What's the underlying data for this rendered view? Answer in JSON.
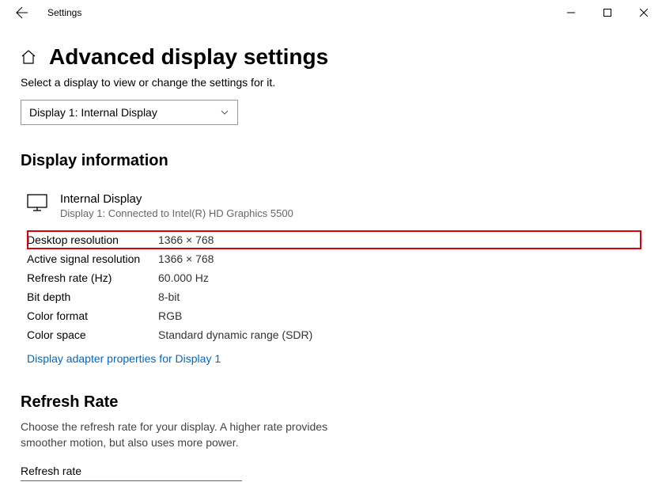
{
  "window": {
    "title": "Settings"
  },
  "page": {
    "heading": "Advanced display settings",
    "subtext": "Select a display to view or change the settings for it."
  },
  "dropdown": {
    "selected": "Display 1: Internal Display"
  },
  "section1": {
    "heading": "Display information",
    "display_name": "Internal Display",
    "display_sub": "Display 1: Connected to Intel(R) HD Graphics 5500"
  },
  "info": [
    {
      "label": "Desktop resolution",
      "value": "1366 × 768"
    },
    {
      "label": "Active signal resolution",
      "value": "1366 × 768"
    },
    {
      "label": "Refresh rate (Hz)",
      "value": "60.000 Hz"
    },
    {
      "label": "Bit depth",
      "value": "8-bit"
    },
    {
      "label": "Color format",
      "value": "RGB"
    },
    {
      "label": "Color space",
      "value": "Standard dynamic range (SDR)"
    }
  ],
  "link": {
    "adapter_props": "Display adapter properties for Display 1"
  },
  "section2": {
    "heading": "Refresh Rate",
    "desc": "Choose the refresh rate for your display. A higher rate provides smoother motion, but also uses more power.",
    "label": "Refresh rate"
  }
}
